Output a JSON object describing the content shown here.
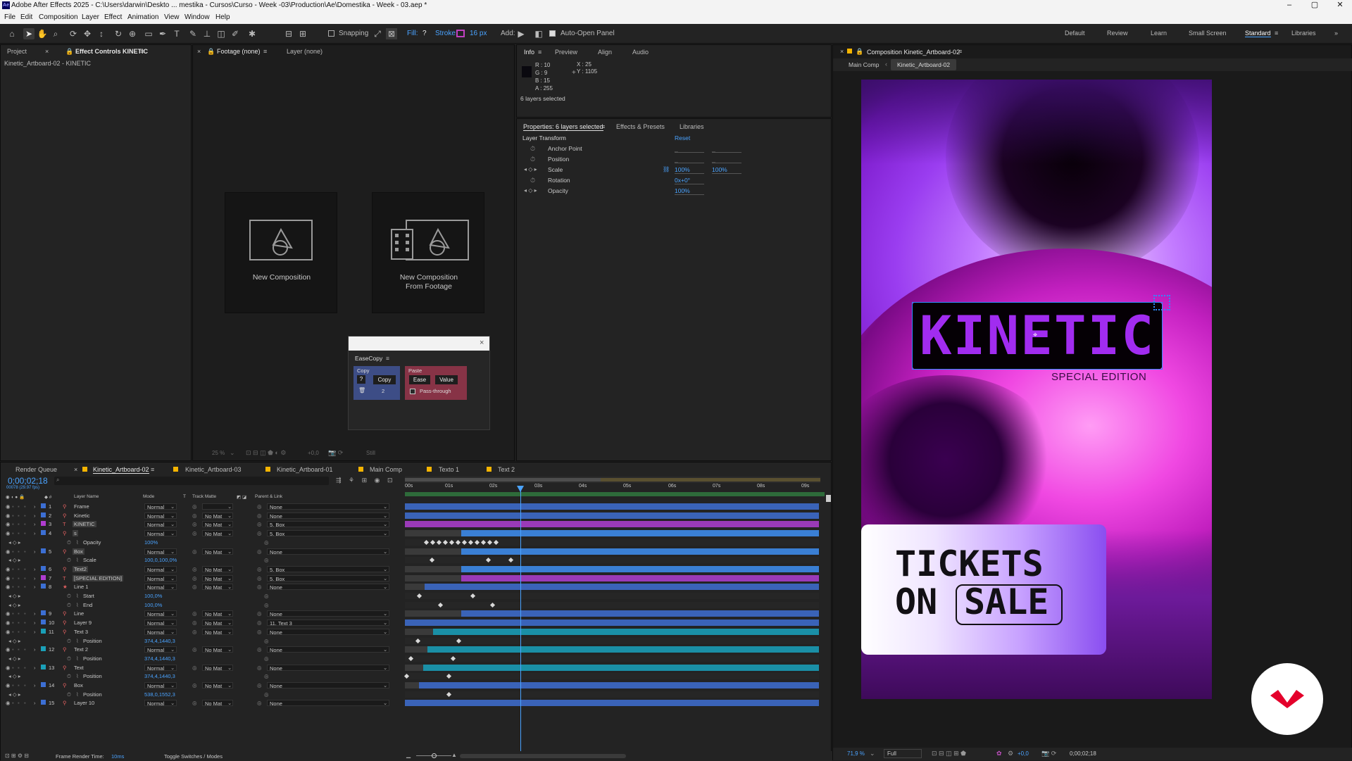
{
  "window": {
    "title": "Adobe After Effects 2025 - C:\\Users\\darwin\\Deskto ... mestika - Cursos\\Curso - Week -03\\Production\\Ae\\Domestika - Week - 03.aep *"
  },
  "menu": [
    "File",
    "Edit",
    "Composition",
    "Layer",
    "Effect",
    "Animation",
    "View",
    "Window",
    "Help"
  ],
  "toolbar": {
    "snapping": "Snapping",
    "fill": "Fill:",
    "stroke": "Stroke:",
    "stroke_px": "16 px",
    "add": "Add:",
    "auto_open": "Auto-Open Panel"
  },
  "workspaces": [
    "Default",
    "Review",
    "Learn",
    "Small Screen",
    "Standard",
    "Libraries"
  ],
  "project_panel": {
    "tab_project": "Project",
    "tab_effect_controls": "Effect Controls KINETIC",
    "subtitle": "Kinetic_Artboard-02 - KINETIC"
  },
  "footage_panel": {
    "tab_footage": "Footage (none)",
    "tab_layer": "Layer (none)",
    "card1": "New Composition",
    "card2a": "New Composition",
    "card2b": "From Footage",
    "zoom": "25 %",
    "exposure": "+0,0",
    "still": "Still"
  },
  "easecopy": {
    "title": "EaseCopy",
    "copy": "Copy",
    "copy_btn": "Copy",
    "q": "?",
    "count": "2",
    "paste": "Paste",
    "ease": "Ease",
    "value": "Value",
    "pass": "Pass-through"
  },
  "info_panel": {
    "tabs": [
      "Info",
      "Preview",
      "Align",
      "Audio"
    ],
    "r": "R : 10",
    "g": "G : 9",
    "b": "B : 15",
    "a": "A : 255",
    "x": "X : 25",
    "y": "Y : 1105",
    "status": "6 layers selected"
  },
  "properties_panel": {
    "tabs": [
      "Properties: 6 layers selected",
      "Effects & Presets",
      "Libraries"
    ],
    "section": "Layer Transform",
    "reset": "Reset",
    "rows": [
      {
        "name": "Anchor Point",
        "v1": "_",
        "v2": "_"
      },
      {
        "name": "Position",
        "v1": "_",
        "v2": "_"
      },
      {
        "name": "Scale",
        "v1": "100%",
        "v2": "100%"
      },
      {
        "name": "Rotation",
        "v1": "0x+0°",
        "v2": ""
      },
      {
        "name": "Opacity",
        "v1": "100%",
        "v2": ""
      }
    ]
  },
  "comp_panel": {
    "tab": "Composition Kinetic_Artboard-02",
    "crumb1": "Main Comp",
    "crumb2": "Kinetic_Artboard-02",
    "zoom": "71,9 %",
    "quality": "Full",
    "exposure": "+0,0",
    "timecode": "0;00;02;18"
  },
  "artwork": {
    "headline": "KINETIC",
    "subline": "SPECIAL EDITION",
    "tickets1": "TICKETS",
    "tickets2": "ON",
    "tickets3": "SALE",
    "brand_color": "#e4002b"
  },
  "timeline": {
    "tabs": [
      "Render Queue",
      "Kinetic_Artboard-02",
      "Kinetic_Artboard-03",
      "Kinetic_Artboard-01",
      "Main Comp",
      "Texto 1",
      "Text 2"
    ],
    "timecode": "0;00;02;18",
    "fps": "00078 (29.97 fps)",
    "headers": {
      "layer": "Layer Name",
      "mode": "Mode",
      "t": "T",
      "matte": "Track Matte",
      "parent": "Parent & Link"
    },
    "ruler": [
      "00s",
      "01s",
      "02s",
      "03s",
      "04s",
      "05s",
      "06s",
      "07s",
      "08s",
      "09s"
    ],
    "render_time_label": "Frame Render Time:",
    "render_time": "10ms",
    "toggle": "Toggle Switches / Modes",
    "rows": [
      {
        "idx": "1",
        "icon": "⚲",
        "name": "Frame",
        "mode": "Normal",
        "matte": "",
        "parent": "None",
        "color": "#3c6fd4",
        "kind": "layer"
      },
      {
        "idx": "2",
        "icon": "⚲",
        "name": "Kinetic",
        "mode": "Normal",
        "matte": "No Mat",
        "parent": "None",
        "color": "#3c6fd4",
        "kind": "layer"
      },
      {
        "idx": "3",
        "icon": "T",
        "name": "KINETIC",
        "mode": "Normal",
        "matte": "No Mat",
        "parent": "5. Box",
        "color": "#b03ccf",
        "kind": "layer"
      },
      {
        "idx": "4",
        "icon": "⚲",
        "name": "s",
        "mode": "Normal",
        "matte": "No Mat",
        "parent": "5. Box",
        "color": "#3c6fd4",
        "kind": "layer"
      },
      {
        "idx": "",
        "icon": "",
        "name": "Opacity",
        "mode": "100%",
        "matte": "",
        "parent": "",
        "color": "",
        "kind": "prop"
      },
      {
        "idx": "5",
        "icon": "⚲",
        "name": "Box",
        "mode": "Normal",
        "matte": "No Mat",
        "parent": "None",
        "color": "#3c6fd4",
        "kind": "layer"
      },
      {
        "idx": "",
        "icon": "",
        "name": "Scale",
        "mode": "100,0,100,0%",
        "matte": "",
        "parent": "",
        "color": "",
        "kind": "prop"
      },
      {
        "idx": "6",
        "icon": "⚲",
        "name": "Text2",
        "mode": "Normal",
        "matte": "No Mat",
        "parent": "5. Box",
        "color": "#3c6fd4",
        "kind": "layer"
      },
      {
        "idx": "7",
        "icon": "T",
        "name": "[SPECIAL EDITION]",
        "mode": "Normal",
        "matte": "No Mat",
        "parent": "5. Box",
        "color": "#b03ccf",
        "kind": "layer"
      },
      {
        "idx": "8",
        "icon": "★",
        "name": "Line 1",
        "mode": "Normal",
        "matte": "No Mat",
        "parent": "None",
        "color": "#3c6fd4",
        "kind": "layer"
      },
      {
        "idx": "",
        "icon": "",
        "name": "Start",
        "mode": "100,0%",
        "matte": "",
        "parent": "",
        "color": "",
        "kind": "prop"
      },
      {
        "idx": "",
        "icon": "",
        "name": "End",
        "mode": "100,0%",
        "matte": "",
        "parent": "",
        "color": "",
        "kind": "prop"
      },
      {
        "idx": "9",
        "icon": "⚲",
        "name": "Line",
        "mode": "Normal",
        "matte": "No Mat",
        "parent": "None",
        "color": "#3c6fd4",
        "kind": "layer"
      },
      {
        "idx": "10",
        "icon": "⚲",
        "name": "Layer 9",
        "mode": "Normal",
        "matte": "No Mat",
        "parent": "11. Text 3",
        "color": "#3c6fd4",
        "kind": "layer"
      },
      {
        "idx": "11",
        "icon": "⚲",
        "name": "Text 3",
        "mode": "Normal",
        "matte": "No Mat",
        "parent": "None",
        "color": "#1aa0b8",
        "kind": "layer"
      },
      {
        "idx": "",
        "icon": "",
        "name": "Position",
        "mode": "374,4,1440,3",
        "matte": "",
        "parent": "",
        "color": "",
        "kind": "prop"
      },
      {
        "idx": "12",
        "icon": "⚲",
        "name": "Text 2",
        "mode": "Normal",
        "matte": "No Mat",
        "parent": "None",
        "color": "#1aa0b8",
        "kind": "layer"
      },
      {
        "idx": "",
        "icon": "",
        "name": "Position",
        "mode": "374,4,1440,3",
        "matte": "",
        "parent": "",
        "color": "",
        "kind": "prop"
      },
      {
        "idx": "13",
        "icon": "⚲",
        "name": "Text",
        "mode": "Normal",
        "matte": "No Mat",
        "parent": "None",
        "color": "#1aa0b8",
        "kind": "layer"
      },
      {
        "idx": "",
        "icon": "",
        "name": "Position",
        "mode": "374,4,1440,3",
        "matte": "",
        "parent": "",
        "color": "",
        "kind": "prop"
      },
      {
        "idx": "14",
        "icon": "⚲",
        "name": "Box",
        "mode": "Normal",
        "matte": "No Mat",
        "parent": "None",
        "color": "#3c6fd4",
        "kind": "layer"
      },
      {
        "idx": "",
        "icon": "",
        "name": "Position",
        "mode": "538,0,1552,3",
        "matte": "",
        "parent": "",
        "color": "",
        "kind": "prop"
      },
      {
        "idx": "15",
        "icon": "⚲",
        "name": "Layer 10",
        "mode": "Normal",
        "matte": "No Mat",
        "parent": "None",
        "color": "#3c6fd4",
        "kind": "layer"
      }
    ]
  }
}
